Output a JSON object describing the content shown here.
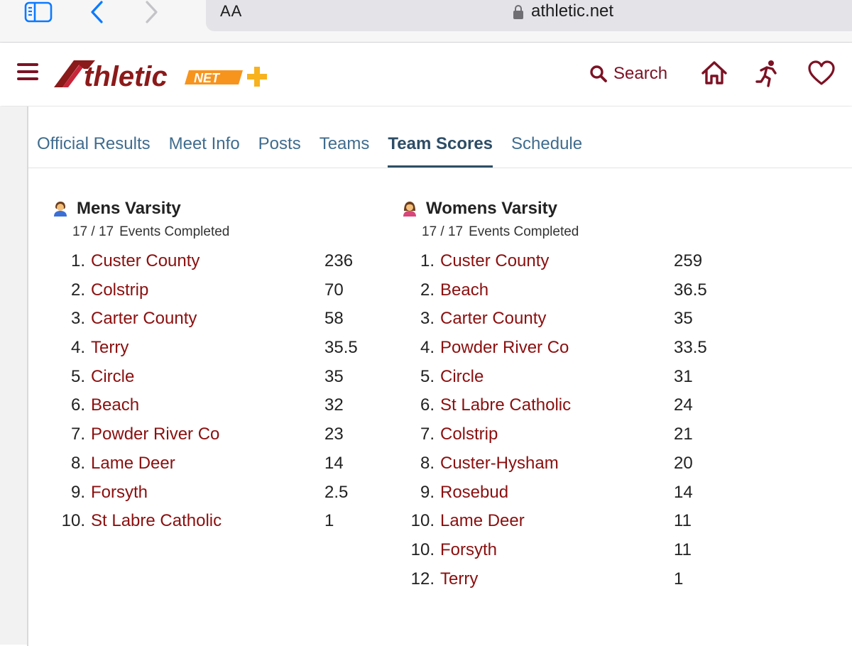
{
  "browser": {
    "aa_label": "AA",
    "url": "athletic.net"
  },
  "header": {
    "search_label": "Search"
  },
  "tabs": [
    {
      "label": "Official Results"
    },
    {
      "label": "Meet Info"
    },
    {
      "label": "Posts"
    },
    {
      "label": "Teams"
    },
    {
      "label": "Team Scores",
      "active": true
    },
    {
      "label": "Schedule"
    }
  ],
  "divisions": [
    {
      "title": "Mens Varsity",
      "events_completed": "17 / 17",
      "events_label": "Events Completed",
      "icon": "male-person-icon",
      "rows": [
        {
          "rank": "1.",
          "team": "Custer County",
          "points": "236"
        },
        {
          "rank": "2.",
          "team": "Colstrip",
          "points": "70"
        },
        {
          "rank": "3.",
          "team": "Carter County",
          "points": "58"
        },
        {
          "rank": "4.",
          "team": "Terry",
          "points": "35.5"
        },
        {
          "rank": "5.",
          "team": "Circle",
          "points": "35"
        },
        {
          "rank": "6.",
          "team": "Beach",
          "points": "32"
        },
        {
          "rank": "7.",
          "team": "Powder River Co",
          "points": "23"
        },
        {
          "rank": "8.",
          "team": "Lame Deer",
          "points": "14"
        },
        {
          "rank": "9.",
          "team": "Forsyth",
          "points": "2.5"
        },
        {
          "rank": "10.",
          "team": "St Labre Catholic",
          "points": "1"
        }
      ]
    },
    {
      "title": "Womens Varsity",
      "events_completed": "17 / 17",
      "events_label": "Events Completed",
      "icon": "female-person-icon",
      "rows": [
        {
          "rank": "1.",
          "team": "Custer County",
          "points": "259"
        },
        {
          "rank": "2.",
          "team": "Beach",
          "points": "36.5"
        },
        {
          "rank": "3.",
          "team": "Carter County",
          "points": "35"
        },
        {
          "rank": "4.",
          "team": "Powder River Co",
          "points": "33.5"
        },
        {
          "rank": "5.",
          "team": "Circle",
          "points": "31"
        },
        {
          "rank": "6.",
          "team": "St Labre Catholic",
          "points": "24"
        },
        {
          "rank": "7.",
          "team": "Colstrip",
          "points": "21"
        },
        {
          "rank": "8.",
          "team": "Custer-Hysham",
          "points": "20"
        },
        {
          "rank": "9.",
          "team": "Rosebud",
          "points": "14"
        },
        {
          "rank": "10.",
          "team": "Lame Deer",
          "points": "11"
        },
        {
          "rank": "10.",
          "team": "Forsyth",
          "points": "11"
        },
        {
          "rank": "12.",
          "team": "Terry",
          "points": "1"
        }
      ]
    }
  ],
  "colors": {
    "brand": "#7c1224",
    "team_link": "#8b0f0f",
    "tab": "#3f6c8e",
    "tab_active": "#2d4d66",
    "logo_orange": "#f7941d"
  }
}
